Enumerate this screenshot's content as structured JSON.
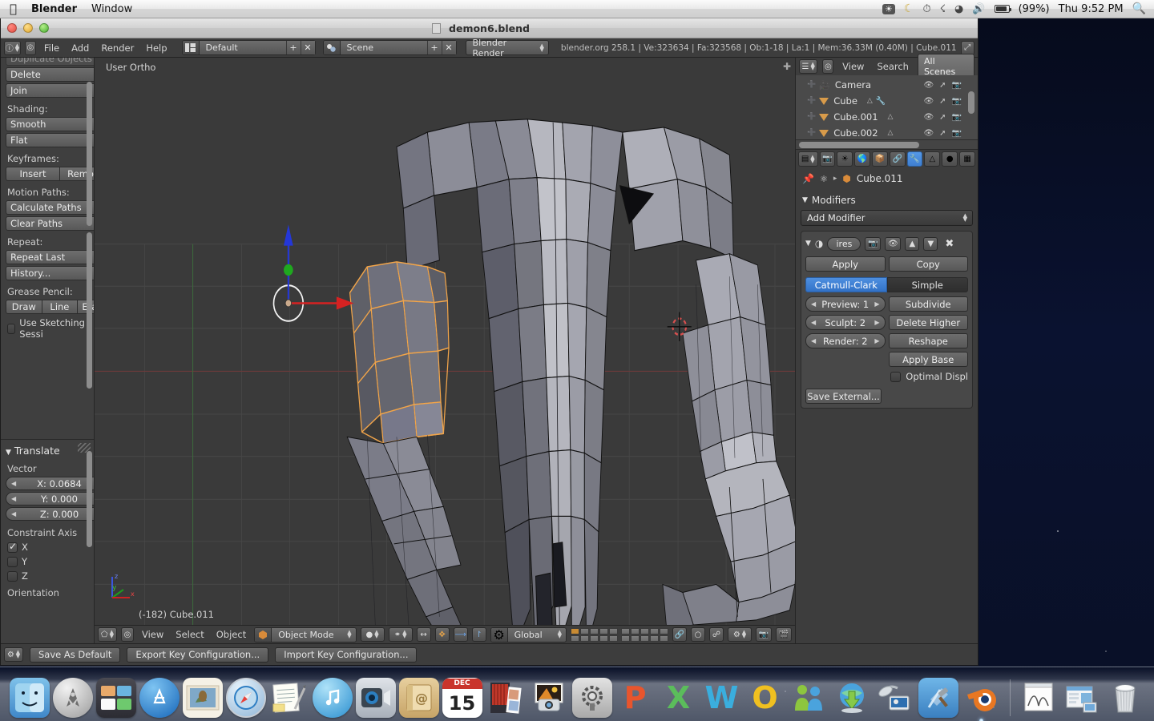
{
  "menubar": {
    "apple": "apple-logo",
    "app_name": "Blender",
    "items": [
      "Window"
    ],
    "status_icons": [
      "flux-icon",
      "moon-icon",
      "time-machine-icon",
      "bluetooth-icon",
      "wifi-icon",
      "volume-icon"
    ],
    "battery": "(99%)",
    "clock": "Thu 9:52 PM",
    "search": "spotlight-icon"
  },
  "window": {
    "title": "demon6.blend"
  },
  "topbar": {
    "editor_icon": "info-editor-icon",
    "menus": [
      "File",
      "Add",
      "Render",
      "Help"
    ],
    "screen_layout": {
      "icon": "screen-layout-icon",
      "value": "Default",
      "add": "+",
      "remove": "✕"
    },
    "scene": {
      "icon": "scene-icon",
      "value": "Scene",
      "add": "+",
      "remove": "✕"
    },
    "render_engine": "Blender Render",
    "status": "blender.org 258.1 | Ve:323634 | Fa:323568 | Ob:1-18 | La:1 | Mem:36.33M (0.40M) | Cube.011"
  },
  "toolshelf": {
    "cut_off_top": "Duplicate Objects",
    "buttons_top": [
      "Delete",
      "Join"
    ],
    "shading_label": "Shading:",
    "shading_buttons": [
      "Smooth",
      "Flat"
    ],
    "keyframes_label": "Keyframes:",
    "keyframes_buttons": [
      "Insert",
      "Remove"
    ],
    "motion_paths_label": "Motion Paths:",
    "motion_paths_buttons": [
      "Calculate Paths",
      "Clear Paths"
    ],
    "repeat_label": "Repeat:",
    "repeat_buttons": [
      "Repeat Last",
      "History..."
    ],
    "grease_pencil_label": "Grease Pencil:",
    "grease_pencil_buttons": [
      "Draw",
      "Line",
      "Erase"
    ],
    "sketching_checkbox": {
      "label": "Use Sketching Sessi",
      "checked": false
    }
  },
  "operator_panel": {
    "title": "Translate",
    "vector_label": "Vector",
    "fields": [
      {
        "label": "X: 0.0684"
      },
      {
        "label": "Y: 0.000"
      },
      {
        "label": "Z: 0.000"
      }
    ],
    "constraint_label": "Constraint Axis",
    "axes": [
      {
        "label": "X",
        "checked": true
      },
      {
        "label": "Y",
        "checked": false
      },
      {
        "label": "Z",
        "checked": false
      }
    ],
    "orientation_label": "Orientation"
  },
  "viewport": {
    "view_label": "User Ortho",
    "object_info": "(-182) Cube.011",
    "axis_gizmo": {
      "z": "z",
      "y": "y",
      "x": "x"
    },
    "header": {
      "editor_icon": "3d-view-editor-icon",
      "menus": [
        "View",
        "Select",
        "Object"
      ],
      "mode": "Object Mode",
      "shading": "solid-shading-icon",
      "pivot": "pivot-icon",
      "manipulator_icons": [
        "translate-manipulator-icon",
        "rotate-manipulator-icon",
        "scale-manipulator-icon"
      ],
      "orientation": "Global",
      "layers": "layer-grid",
      "active_layer": 1,
      "extra_icons": [
        "lock-scene-icon",
        "proportional-edit-icon",
        "snap-magnet-icon",
        "snap-target-icon",
        "render-preview-icon",
        "render-animation-icon"
      ]
    }
  },
  "outliner": {
    "editor_icon": "outliner-editor-icon",
    "menus": [
      "View",
      "Search"
    ],
    "display_mode": "All Scenes",
    "rows": [
      {
        "name": "Camera",
        "type_icon": "camera-icon",
        "extra_icons": [
          "camera-data-icon"
        ]
      },
      {
        "name": "Cube",
        "type_icon": "mesh-triangle-icon",
        "extra_icons": [
          "mesh-data-icon",
          "modifier-wrench-icon"
        ]
      },
      {
        "name": "Cube.001",
        "type_icon": "mesh-triangle-icon",
        "extra_icons": [
          "mesh-data-icon"
        ]
      },
      {
        "name": "Cube.002",
        "type_icon": "mesh-triangle-icon",
        "extra_icons": [
          "mesh-data-icon"
        ]
      }
    ],
    "row_toggles": [
      "eye-icon",
      "cursor-arrow-icon",
      "camera-render-icon"
    ]
  },
  "properties": {
    "editor_icon": "properties-editor-icon",
    "tabs": [
      "render-tab",
      "scene-tab",
      "world-tab",
      "object-tab",
      "constraints-tab",
      "modifiers-tab",
      "data-tab",
      "material-tab",
      "texture-tab"
    ],
    "active_tab_index": 5,
    "breadcrumb": {
      "pin": "pin-icon",
      "object_icon": "object-icon",
      "separator": "▸",
      "value": "Cube.011"
    },
    "panel_title": "Modifiers",
    "add_modifier": "Add Modifier",
    "modifier": {
      "name": "ires",
      "header_icons": [
        "expand-triangle-icon",
        "display-mode-icon",
        "render-toggle-icon",
        "viewport-toggle-icon",
        "move-up-icon",
        "move-down-icon",
        "delete-x-icon"
      ],
      "apply": "Apply",
      "copy": "Copy",
      "subdivision_type": [
        {
          "label": "Catmull-Clark",
          "selected": true
        },
        {
          "label": "Simple",
          "selected": false
        }
      ],
      "levels": [
        {
          "label": "Preview: 1"
        },
        {
          "label": "Sculpt: 2"
        },
        {
          "label": "Render: 2"
        }
      ],
      "actions": [
        "Subdivide",
        "Delete Higher",
        "Reshape",
        "Apply Base"
      ],
      "optimal_display": {
        "label": "Optimal Displ",
        "checked": false
      },
      "save_external": "Save External..."
    }
  },
  "prefbar": {
    "editor_icon": "user-preferences-editor-icon",
    "buttons": [
      "Save As Default",
      "Export Key Configuration...",
      "Import Key Configuration..."
    ]
  },
  "dock": {
    "items": [
      {
        "name": "finder",
        "label": "Finder"
      },
      {
        "name": "launchpad",
        "label": "Launchpad"
      },
      {
        "name": "mission-control",
        "label": "Mission Control"
      },
      {
        "name": "app-store",
        "label": "App Store"
      },
      {
        "name": "mail",
        "label": "Mail"
      },
      {
        "name": "safari",
        "label": "Safari"
      },
      {
        "name": "notes",
        "label": "Notes"
      },
      {
        "name": "itunes",
        "label": "iTunes"
      },
      {
        "name": "facetime",
        "label": "FaceTime"
      },
      {
        "name": "address-book",
        "label": "Address Book"
      },
      {
        "name": "ical",
        "label": "iCal"
      },
      {
        "name": "photo-booth",
        "label": "Photo Booth"
      },
      {
        "name": "iphoto",
        "label": "iPhoto"
      },
      {
        "name": "system-preferences",
        "label": "System Preferences"
      },
      {
        "name": "powerpoint",
        "label": "P"
      },
      {
        "name": "excel",
        "label": "X"
      },
      {
        "name": "word",
        "label": "W"
      },
      {
        "name": "outlook",
        "label": "O"
      },
      {
        "name": "messenger",
        "label": "Messenger"
      },
      {
        "name": "download-manager",
        "label": "Download"
      },
      {
        "name": "remote-desktop",
        "label": "Remote Desktop"
      },
      {
        "name": "xcode",
        "label": "Xcode"
      },
      {
        "name": "blender",
        "label": "Blender",
        "running": true
      },
      {
        "name": "documents-stack",
        "label": "Documents"
      },
      {
        "name": "downloads-stack",
        "label": "Downloads"
      },
      {
        "name": "trash",
        "label": "Trash"
      }
    ],
    "calendar_month": "DEC",
    "calendar_day": "15"
  }
}
